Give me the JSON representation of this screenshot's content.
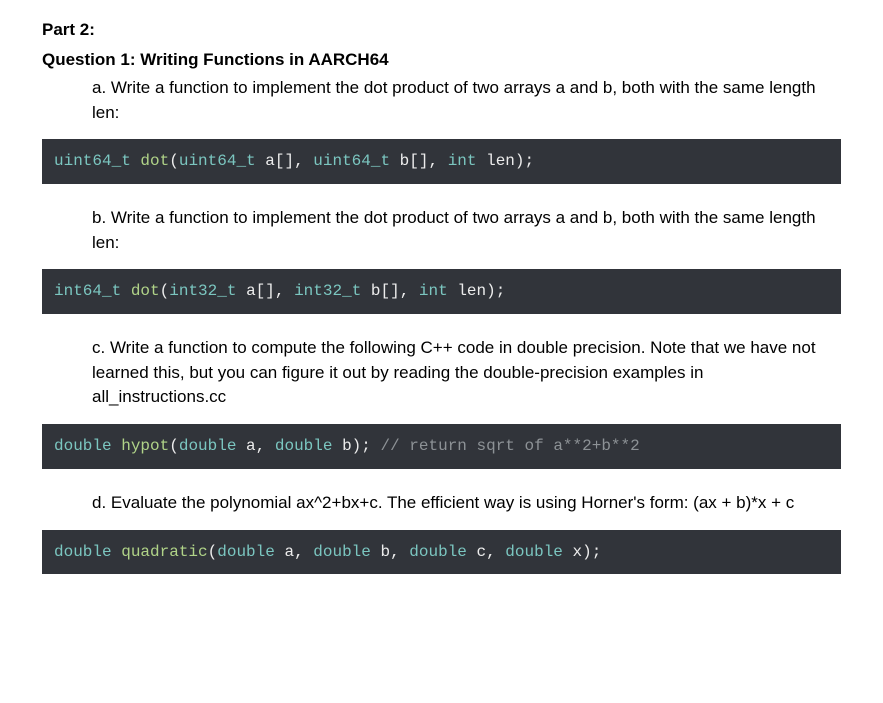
{
  "part_label": "Part 2:",
  "question_label": "Question 1: Writing Functions in AARCH64",
  "a_text": "a. Write a function to implement the dot product of two arrays a and b, both with the same length len:",
  "b_text": "b. Write a function to implement the dot product of two arrays a and b, both with the same length len:",
  "c_text": "c. Write a function to compute the following C++ code in double precision. Note that we have not learned this, but you can figure it out by reading the double-precision examples in all_instructions.cc",
  "d_text": "d. Evaluate the polynomial ax^2+bx+c. The efficient way is using Horner's form: (ax + b)*x + c",
  "code_a": {
    "t1": "uint64_t",
    "sp1": " ",
    "fn": "dot",
    "p1": "(",
    "t2": "uint64_t",
    "a1": " a[], ",
    "t3": "uint64_t",
    "a2": " b[], ",
    "kw": "int",
    "a3": " len);"
  },
  "code_b": {
    "t1": "int64_t",
    "sp1": " ",
    "fn": "dot",
    "p1": "(",
    "t2": "int32_t",
    "a1": " a[], ",
    "t3": "int32_t",
    "a2": " b[], ",
    "kw": "int",
    "a3": " len);"
  },
  "code_c": {
    "t1": "double",
    "sp1": " ",
    "fn": "hypot",
    "p1": "(",
    "t2": "double",
    "a1": " a, ",
    "t3": "double",
    "a2": " b); ",
    "comment": "// return sqrt of a**2+b**2"
  },
  "code_d": {
    "t1": "double",
    "sp1": " ",
    "fn": "quadratic",
    "p1": "(",
    "t2": "double",
    "a1": " a, ",
    "t3": "double",
    "a2": " b, ",
    "t4": "double",
    "a3": " c, ",
    "t5": "double",
    "a4": " x);"
  }
}
